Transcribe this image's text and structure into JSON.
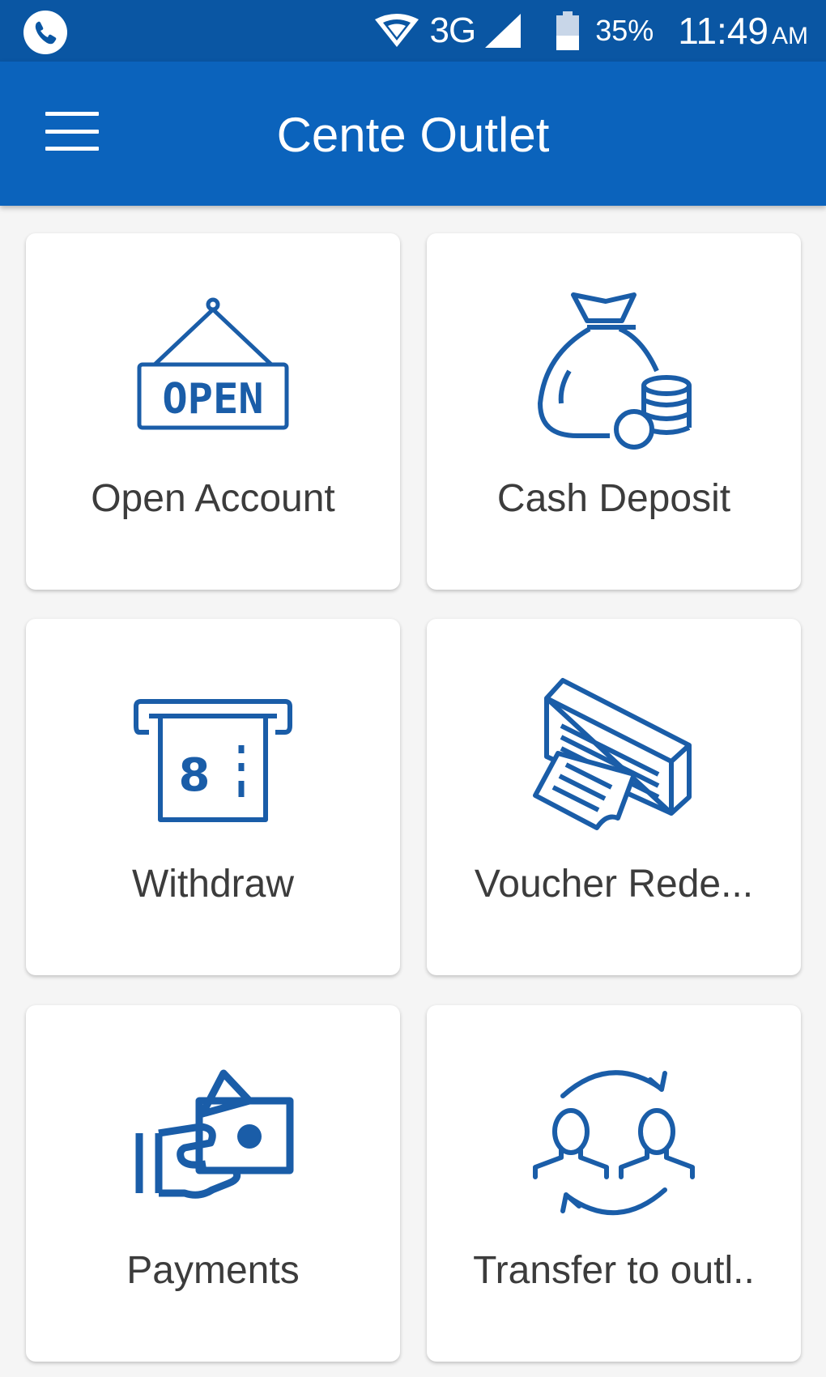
{
  "status_bar": {
    "network_type": "3G",
    "battery_percent": "35%",
    "time": "11:49",
    "am_pm": "AM"
  },
  "app_bar": {
    "title": "Cente Outlet"
  },
  "tiles": [
    {
      "label": "Open Account",
      "icon": "open-sign-icon",
      "sign_text": "OPEN"
    },
    {
      "label": "Cash Deposit",
      "icon": "money-bag-icon"
    },
    {
      "label": "Withdraw",
      "icon": "atm-withdraw-icon"
    },
    {
      "label": "Voucher Rede...",
      "icon": "voucher-printer-icon"
    },
    {
      "label": "Payments",
      "icon": "cash-hand-icon"
    },
    {
      "label": "Transfer to outl..",
      "icon": "user-transfer-icon"
    }
  ],
  "colors": {
    "status_bar": "#0a56a3",
    "app_bar": "#0b63bc",
    "icon_blue": "#1a5da8",
    "label_text": "#3c3c3c",
    "background": "#f5f5f5"
  }
}
